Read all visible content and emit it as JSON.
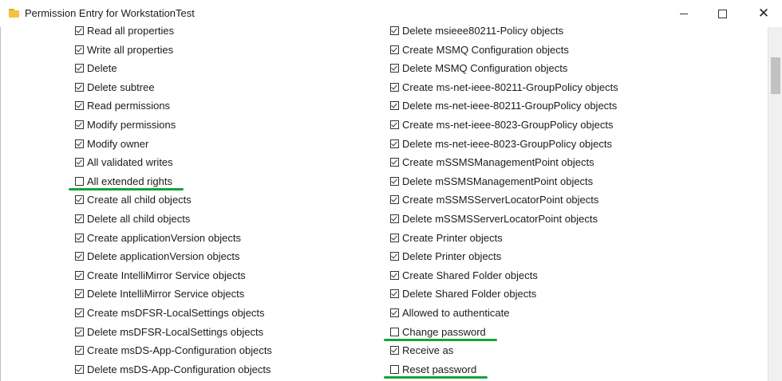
{
  "window": {
    "title": "Permission Entry for WorkstationTest",
    "icon": "folder-icon",
    "controls": {
      "minimize": "minimize-icon",
      "maximize": "maximize-icon",
      "close": "✕"
    }
  },
  "permissions": {
    "left": [
      {
        "label": "Read all properties",
        "checked": true
      },
      {
        "label": "Write all properties",
        "checked": true
      },
      {
        "label": "Delete",
        "checked": true
      },
      {
        "label": "Delete subtree",
        "checked": true
      },
      {
        "label": "Read permissions",
        "checked": true
      },
      {
        "label": "Modify permissions",
        "checked": true
      },
      {
        "label": "Modify owner",
        "checked": true
      },
      {
        "label": "All validated writes",
        "checked": true
      },
      {
        "label": "All extended rights",
        "checked": false,
        "highlighted": true
      },
      {
        "label": "Create all child objects",
        "checked": true
      },
      {
        "label": "Delete all child objects",
        "checked": true
      },
      {
        "label": "Create applicationVersion objects",
        "checked": true
      },
      {
        "label": "Delete applicationVersion objects",
        "checked": true
      },
      {
        "label": "Create IntelliMirror Service objects",
        "checked": true
      },
      {
        "label": "Delete IntelliMirror Service objects",
        "checked": true
      },
      {
        "label": "Create msDFSR-LocalSettings objects",
        "checked": true
      },
      {
        "label": "Delete msDFSR-LocalSettings objects",
        "checked": true
      },
      {
        "label": "Create msDS-App-Configuration objects",
        "checked": true
      },
      {
        "label": "Delete msDS-App-Configuration objects",
        "checked": true
      }
    ],
    "right": [
      {
        "label": "Delete msieee80211-Policy objects",
        "checked": true
      },
      {
        "label": "Create MSMQ Configuration objects",
        "checked": true
      },
      {
        "label": "Delete MSMQ Configuration objects",
        "checked": true
      },
      {
        "label": "Create ms-net-ieee-80211-GroupPolicy objects",
        "checked": true
      },
      {
        "label": "Delete ms-net-ieee-80211-GroupPolicy objects",
        "checked": true
      },
      {
        "label": "Create ms-net-ieee-8023-GroupPolicy objects",
        "checked": true
      },
      {
        "label": "Delete ms-net-ieee-8023-GroupPolicy objects",
        "checked": true
      },
      {
        "label": "Create mSSMSManagementPoint objects",
        "checked": true
      },
      {
        "label": "Delete mSSMSManagementPoint objects",
        "checked": true
      },
      {
        "label": "Create mSSMSServerLocatorPoint objects",
        "checked": true
      },
      {
        "label": "Delete mSSMSServerLocatorPoint objects",
        "checked": true
      },
      {
        "label": "Create Printer objects",
        "checked": true
      },
      {
        "label": "Delete Printer objects",
        "checked": true
      },
      {
        "label": "Create Shared Folder objects",
        "checked": true
      },
      {
        "label": "Delete Shared Folder objects",
        "checked": true
      },
      {
        "label": "Allowed to authenticate",
        "checked": true
      },
      {
        "label": "Change password",
        "checked": false,
        "highlighted": true
      },
      {
        "label": "Receive as",
        "checked": true
      },
      {
        "label": "Reset password",
        "checked": false,
        "highlighted": true
      }
    ]
  },
  "colors": {
    "highlight_underline": "#17a33a",
    "text": "#1b1b1b",
    "checkbox_border": "#333333"
  }
}
